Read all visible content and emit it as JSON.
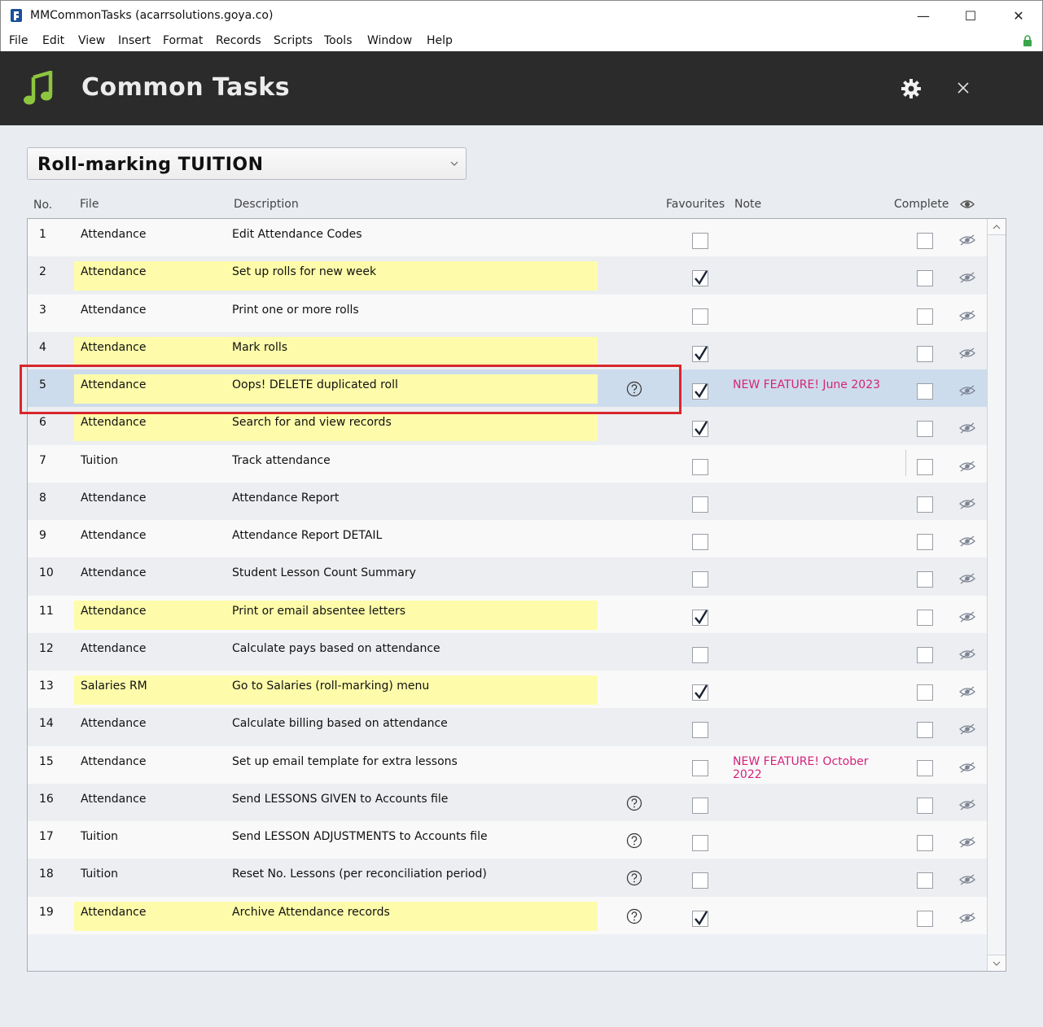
{
  "window": {
    "title": "MMCommonTasks (acarrsolutions.goya.co)",
    "minimize": "—",
    "maximize": "☐",
    "close": "✕"
  },
  "menu": [
    "File",
    "Edit",
    "View",
    "Insert",
    "Format",
    "Records",
    "Scripts",
    "Tools",
    "Window",
    "Help"
  ],
  "header": {
    "title": "Common Tasks",
    "icon": "music-note-icon",
    "accent": "#8dc63f"
  },
  "dropdown": {
    "value": "Roll-marking TUITION"
  },
  "columns": {
    "no": "No.",
    "file": "File",
    "description": "Description",
    "favourites": "Favourites",
    "note": "Note",
    "complete": "Complete"
  },
  "colors": {
    "highlight": "#fefcaa",
    "selected_row": "#cddcec",
    "note_text": "#d4237a",
    "annotation_box": "#d9262d"
  },
  "rows": [
    {
      "no": "1",
      "file": "Attendance",
      "description": "Edit Attendance Codes",
      "favourite": false,
      "help": false,
      "note": "",
      "complete": false
    },
    {
      "no": "2",
      "file": "Attendance",
      "description": "Set up rolls for new week",
      "favourite": true,
      "help": false,
      "note": "",
      "complete": false
    },
    {
      "no": "3",
      "file": "Attendance",
      "description": "Print one or more rolls",
      "favourite": false,
      "help": false,
      "note": "",
      "complete": false
    },
    {
      "no": "4",
      "file": "Attendance",
      "description": "Mark rolls",
      "favourite": true,
      "help": false,
      "note": "",
      "complete": false
    },
    {
      "no": "5",
      "file": "Attendance",
      "description": "Oops! DELETE duplicated roll",
      "favourite": true,
      "help": true,
      "note": "NEW FEATURE! June 2023",
      "complete": false,
      "selected": true
    },
    {
      "no": "6",
      "file": "Attendance",
      "description": "Search for and view records",
      "favourite": true,
      "help": false,
      "note": "",
      "complete": false
    },
    {
      "no": "7",
      "file": "Tuition",
      "description": "Track attendance",
      "favourite": false,
      "help": false,
      "note": "",
      "complete": false
    },
    {
      "no": "8",
      "file": "Attendance",
      "description": "Attendance Report",
      "favourite": false,
      "help": false,
      "note": "",
      "complete": false
    },
    {
      "no": "9",
      "file": "Attendance",
      "description": "Attendance Report DETAIL",
      "favourite": false,
      "help": false,
      "note": "",
      "complete": false
    },
    {
      "no": "10",
      "file": "Attendance",
      "description": "Student Lesson Count Summary",
      "favourite": false,
      "help": false,
      "note": "",
      "complete": false
    },
    {
      "no": "11",
      "file": "Attendance",
      "description": "Print or email absentee letters",
      "favourite": true,
      "help": false,
      "note": "",
      "complete": false
    },
    {
      "no": "12",
      "file": "Attendance",
      "description": "Calculate pays based on attendance",
      "favourite": false,
      "help": false,
      "note": "",
      "complete": false
    },
    {
      "no": "13",
      "file": "Salaries RM",
      "description": "Go to Salaries (roll-marking) menu",
      "favourite": true,
      "help": false,
      "note": "",
      "complete": false
    },
    {
      "no": "14",
      "file": "Attendance",
      "description": "Calculate billing based on attendance",
      "favourite": false,
      "help": false,
      "note": "",
      "complete": false
    },
    {
      "no": "15",
      "file": "Attendance",
      "description": "Set up email template for extra lessons",
      "favourite": false,
      "help": false,
      "note": "NEW FEATURE! October 2022",
      "complete": false
    },
    {
      "no": "16",
      "file": "Attendance",
      "description": "Send LESSONS GIVEN to Accounts file",
      "favourite": false,
      "help": true,
      "note": "",
      "complete": false
    },
    {
      "no": "17",
      "file": "Tuition",
      "description": "Send LESSON ADJUSTMENTS to Accounts file",
      "favourite": false,
      "help": true,
      "note": "",
      "complete": false
    },
    {
      "no": "18",
      "file": "Tuition",
      "description": "Reset No. Lessons (per reconciliation period)",
      "favourite": false,
      "help": true,
      "note": "",
      "complete": false
    },
    {
      "no": "19",
      "file": "Attendance",
      "description": "Archive Attendance records",
      "favourite": true,
      "help": true,
      "note": "",
      "complete": false
    }
  ]
}
